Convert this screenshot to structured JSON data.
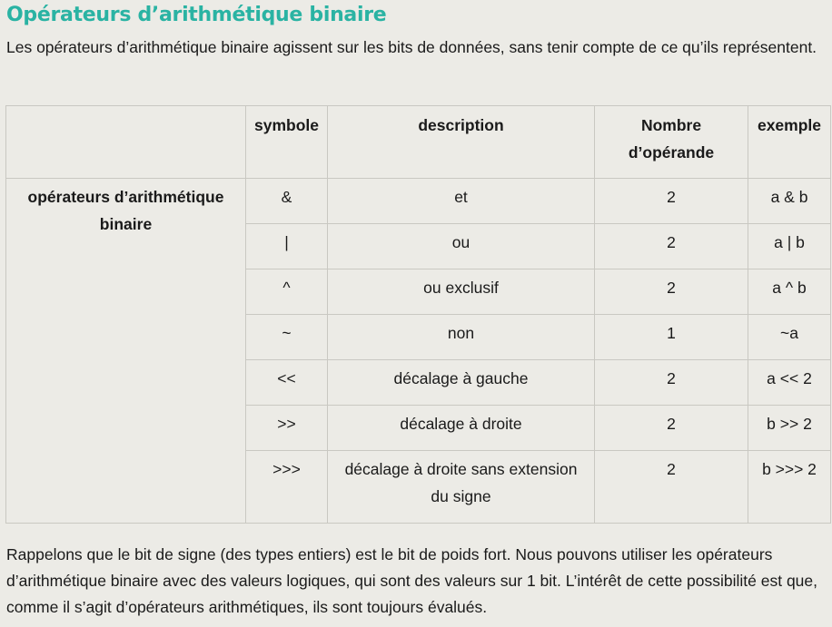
{
  "heading": "Opérateurs d’arithmétique binaire",
  "intro": "Les opérateurs d’arithmétique binaire agissent sur les bits de données, sans tenir compte de ce qu’ils représentent.",
  "table": {
    "headers": [
      "",
      "symbole",
      "description",
      "Nombre d’opérande",
      "exemple"
    ],
    "group_label": "opérateurs d’arithmétique binaire",
    "rows": [
      {
        "symbole": "&",
        "description": "et",
        "nombre": "2",
        "exemple": "a & b"
      },
      {
        "symbole": "|",
        "description": "ou",
        "nombre": "2",
        "exemple": "a | b"
      },
      {
        "symbole": "^",
        "description": "ou exclusif",
        "nombre": "2",
        "exemple": "a ^ b"
      },
      {
        "symbole": "~",
        "description": "non",
        "nombre": "1",
        "exemple": "~a"
      },
      {
        "symbole": "<<",
        "description": "décalage à gauche",
        "nombre": "2",
        "exemple": "a << 2"
      },
      {
        "symbole": ">>",
        "description": "décalage à droite",
        "nombre": "2",
        "exemple": "b >> 2"
      },
      {
        "symbole": ">>>",
        "description": "décalage à droite sans extension du signe",
        "nombre": "2",
        "exemple": "b >>> 2"
      }
    ]
  },
  "outro": "Rappelons que le bit de signe (des types entiers) est le bit de poids fort. Nous pouvons utiliser les opérateurs d’arithmétique binaire avec des valeurs logiques, qui sont des valeurs sur 1 bit. L’intérêt de cette possibilité est que, comme il s’agit d’opérateurs arithmétiques, ils sont toujours évalués.",
  "colors": {
    "heading": "#2ab3a3",
    "background": "#ecebe6",
    "border": "#c9c8c2"
  }
}
